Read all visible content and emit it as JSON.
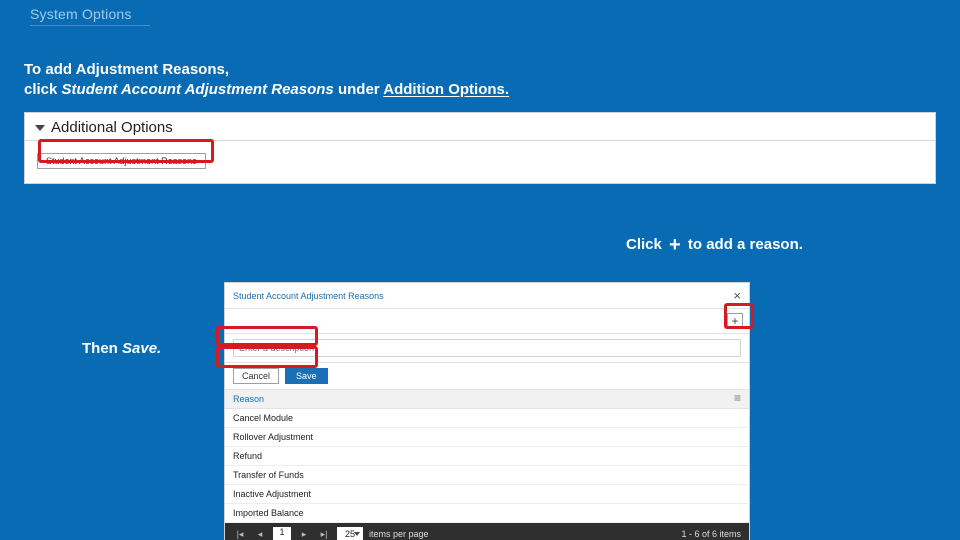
{
  "title": "System Options",
  "instr": {
    "line1": "To add Adjustment Reasons,",
    "line2_pre": "click ",
    "line2_link": "Student Account Adjustment Reasons ",
    "line2_mid": "under ",
    "line2_under": "Addition Options.",
    "line2_post": ""
  },
  "panel1": {
    "header": "Additional Options",
    "button": "Student Account Adjustment Reasons"
  },
  "cap_right": {
    "pre": "Click ",
    "plus": "+",
    "post": " to add a reason."
  },
  "cap_left": {
    "pre": "Then ",
    "action": "Save."
  },
  "dialog": {
    "title": "Student Account Adjustment Reasons",
    "input_placeholder": "Enter a description",
    "cancel": "Cancel",
    "save": "Save",
    "col_header": "Reason",
    "rows": [
      "Cancel Module",
      "Rollover Adjustment",
      "Refund",
      "Transfer of Funds",
      "Inactive Adjustment",
      "Imported Balance"
    ],
    "pager": {
      "page": "1",
      "per_page": "25",
      "per_page_label": "items per page",
      "summary": "1 - 6 of 6 items"
    }
  }
}
